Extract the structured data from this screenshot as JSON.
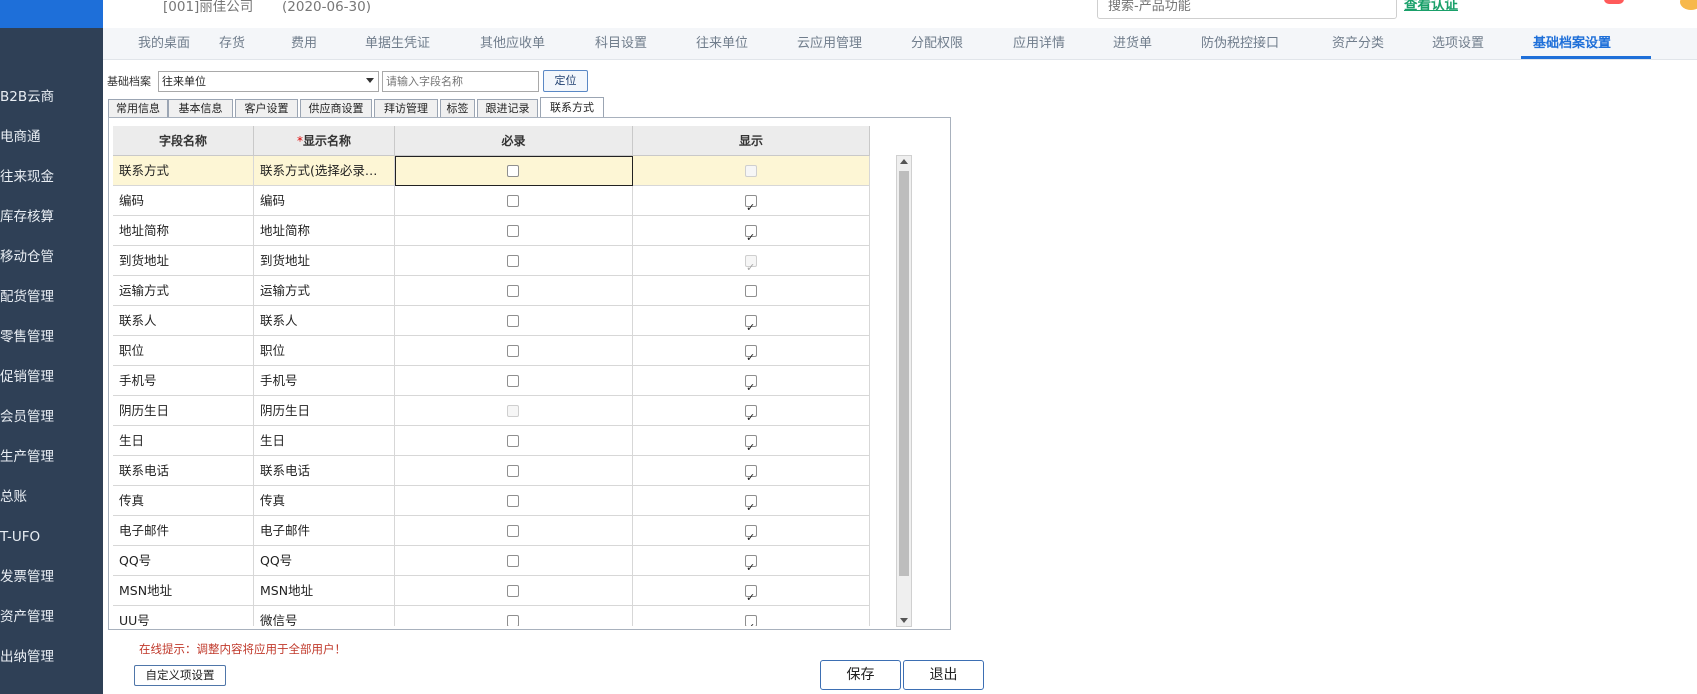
{
  "header": {
    "company": "[001]丽佳公司",
    "date": "(2020-06-30)",
    "search_placeholder": "搜索-产品功能",
    "verify_link": "查看认证"
  },
  "sidebar": {
    "items": [
      {
        "label": "B2B云商"
      },
      {
        "label": "电商通"
      },
      {
        "label": "往来现金"
      },
      {
        "label": "库存核算"
      },
      {
        "label": "移动仓管"
      },
      {
        "label": "配货管理"
      },
      {
        "label": "零售管理"
      },
      {
        "label": "促销管理"
      },
      {
        "label": "会员管理"
      },
      {
        "label": "生产管理"
      },
      {
        "label": "总账"
      },
      {
        "label": "T-UFO"
      },
      {
        "label": "发票管理"
      },
      {
        "label": "资产管理"
      },
      {
        "label": "出纳管理"
      }
    ]
  },
  "topnav": {
    "tabs": [
      {
        "label": "我的桌面"
      },
      {
        "label": "存货"
      },
      {
        "label": "费用"
      },
      {
        "label": "单据生凭证"
      },
      {
        "label": "其他应收单"
      },
      {
        "label": "科目设置"
      },
      {
        "label": "往来单位"
      },
      {
        "label": "云应用管理"
      },
      {
        "label": "分配权限"
      },
      {
        "label": "应用详情"
      },
      {
        "label": "进货单"
      },
      {
        "label": "防伪税控接口"
      },
      {
        "label": "资产分类"
      },
      {
        "label": "选项设置"
      },
      {
        "label": "基础档案设置"
      }
    ],
    "active_index": 14
  },
  "form": {
    "archive_label": "基础档案",
    "archive_selected": "往来单位",
    "field_search_placeholder": "请输入字段名称",
    "locate_button": "定位"
  },
  "subtabs": {
    "items": [
      {
        "label": "常用信息"
      },
      {
        "label": "基本信息"
      },
      {
        "label": "客户设置"
      },
      {
        "label": "供应商设置"
      },
      {
        "label": "拜访管理"
      },
      {
        "label": "标签"
      },
      {
        "label": "跟进记录"
      },
      {
        "label": "联系方式"
      }
    ],
    "active_index": 7
  },
  "grid": {
    "headers": {
      "field_name": "字段名称",
      "required_mark": "*",
      "display_name": "显示名称",
      "required": "必录",
      "display": "显示"
    },
    "rows": [
      {
        "field": "联系方式",
        "display_name": "联系方式(选择必录…",
        "required": false,
        "required_disabled": false,
        "show": false,
        "show_disabled": true
      },
      {
        "field": "编码",
        "display_name": "编码",
        "required": false,
        "required_disabled": false,
        "show": true,
        "show_disabled": false
      },
      {
        "field": "地址简称",
        "display_name": "地址简称",
        "required": false,
        "required_disabled": false,
        "show": true,
        "show_disabled": false
      },
      {
        "field": "到货地址",
        "display_name": "到货地址",
        "required": false,
        "required_disabled": false,
        "show": true,
        "show_disabled": true
      },
      {
        "field": "运输方式",
        "display_name": "运输方式",
        "required": false,
        "required_disabled": false,
        "show": false,
        "show_disabled": false
      },
      {
        "field": "联系人",
        "display_name": "联系人",
        "required": false,
        "required_disabled": false,
        "show": true,
        "show_disabled": false
      },
      {
        "field": "职位",
        "display_name": "职位",
        "required": false,
        "required_disabled": false,
        "show": true,
        "show_disabled": false
      },
      {
        "field": "手机号",
        "display_name": "手机号",
        "required": false,
        "required_disabled": false,
        "show": true,
        "show_disabled": false
      },
      {
        "field": "阴历生日",
        "display_name": "阴历生日",
        "required": false,
        "required_disabled": true,
        "show": true,
        "show_disabled": false
      },
      {
        "field": "生日",
        "display_name": "生日",
        "required": false,
        "required_disabled": false,
        "show": true,
        "show_disabled": false
      },
      {
        "field": "联系电话",
        "display_name": "联系电话",
        "required": false,
        "required_disabled": false,
        "show": true,
        "show_disabled": false
      },
      {
        "field": "传真",
        "display_name": "传真",
        "required": false,
        "required_disabled": false,
        "show": true,
        "show_disabled": false
      },
      {
        "field": "电子邮件",
        "display_name": "电子邮件",
        "required": false,
        "required_disabled": false,
        "show": true,
        "show_disabled": false
      },
      {
        "field": "QQ号",
        "display_name": "QQ号",
        "required": false,
        "required_disabled": false,
        "show": true,
        "show_disabled": false
      },
      {
        "field": "MSN地址",
        "display_name": "MSN地址",
        "required": false,
        "required_disabled": false,
        "show": true,
        "show_disabled": false
      },
      {
        "field": "UU号",
        "display_name": "微信号",
        "required": false,
        "required_disabled": false,
        "show": true,
        "show_disabled": false
      }
    ]
  },
  "footer": {
    "tip": "在线提示：调整内容将应用于全部用户！",
    "custom_button": "自定义项设置",
    "save_button": "保存",
    "exit_button": "退出"
  }
}
